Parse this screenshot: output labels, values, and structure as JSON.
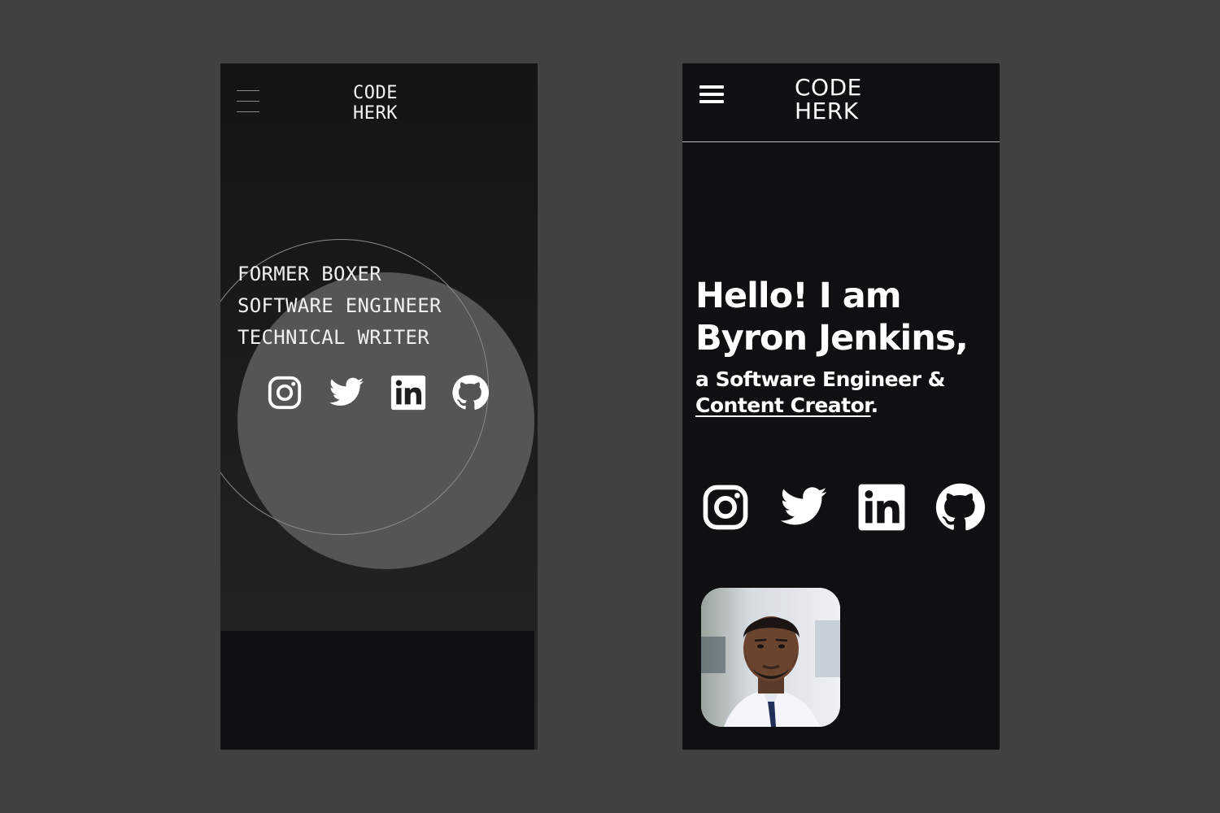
{
  "left_screen": {
    "logo": {
      "line1": "CODE",
      "line2": "HERK"
    },
    "taglines": [
      "FORMER BOXER",
      "SOFTWARE ENGINEER",
      "TECHNICAL WRITER"
    ],
    "socials": [
      "instagram-icon",
      "twitter-icon",
      "linkedin-icon",
      "github-icon"
    ]
  },
  "right_screen": {
    "logo": {
      "line1": "CODE",
      "line2": "HERK"
    },
    "greeting": {
      "line1": "Hello! I am",
      "line2": "Byron Jenkins,"
    },
    "subtitle": {
      "line1": "a Software Engineer &",
      "link": "Content Creator",
      "end": "."
    },
    "socials": [
      "instagram-icon",
      "twitter-icon",
      "linkedin-icon",
      "github-icon"
    ],
    "avatar": "profile-photo"
  },
  "colors": {
    "backdrop": "#414141",
    "screen_dark": "#0f1011",
    "circle_fill": "#555555",
    "text": "#ffffff"
  }
}
